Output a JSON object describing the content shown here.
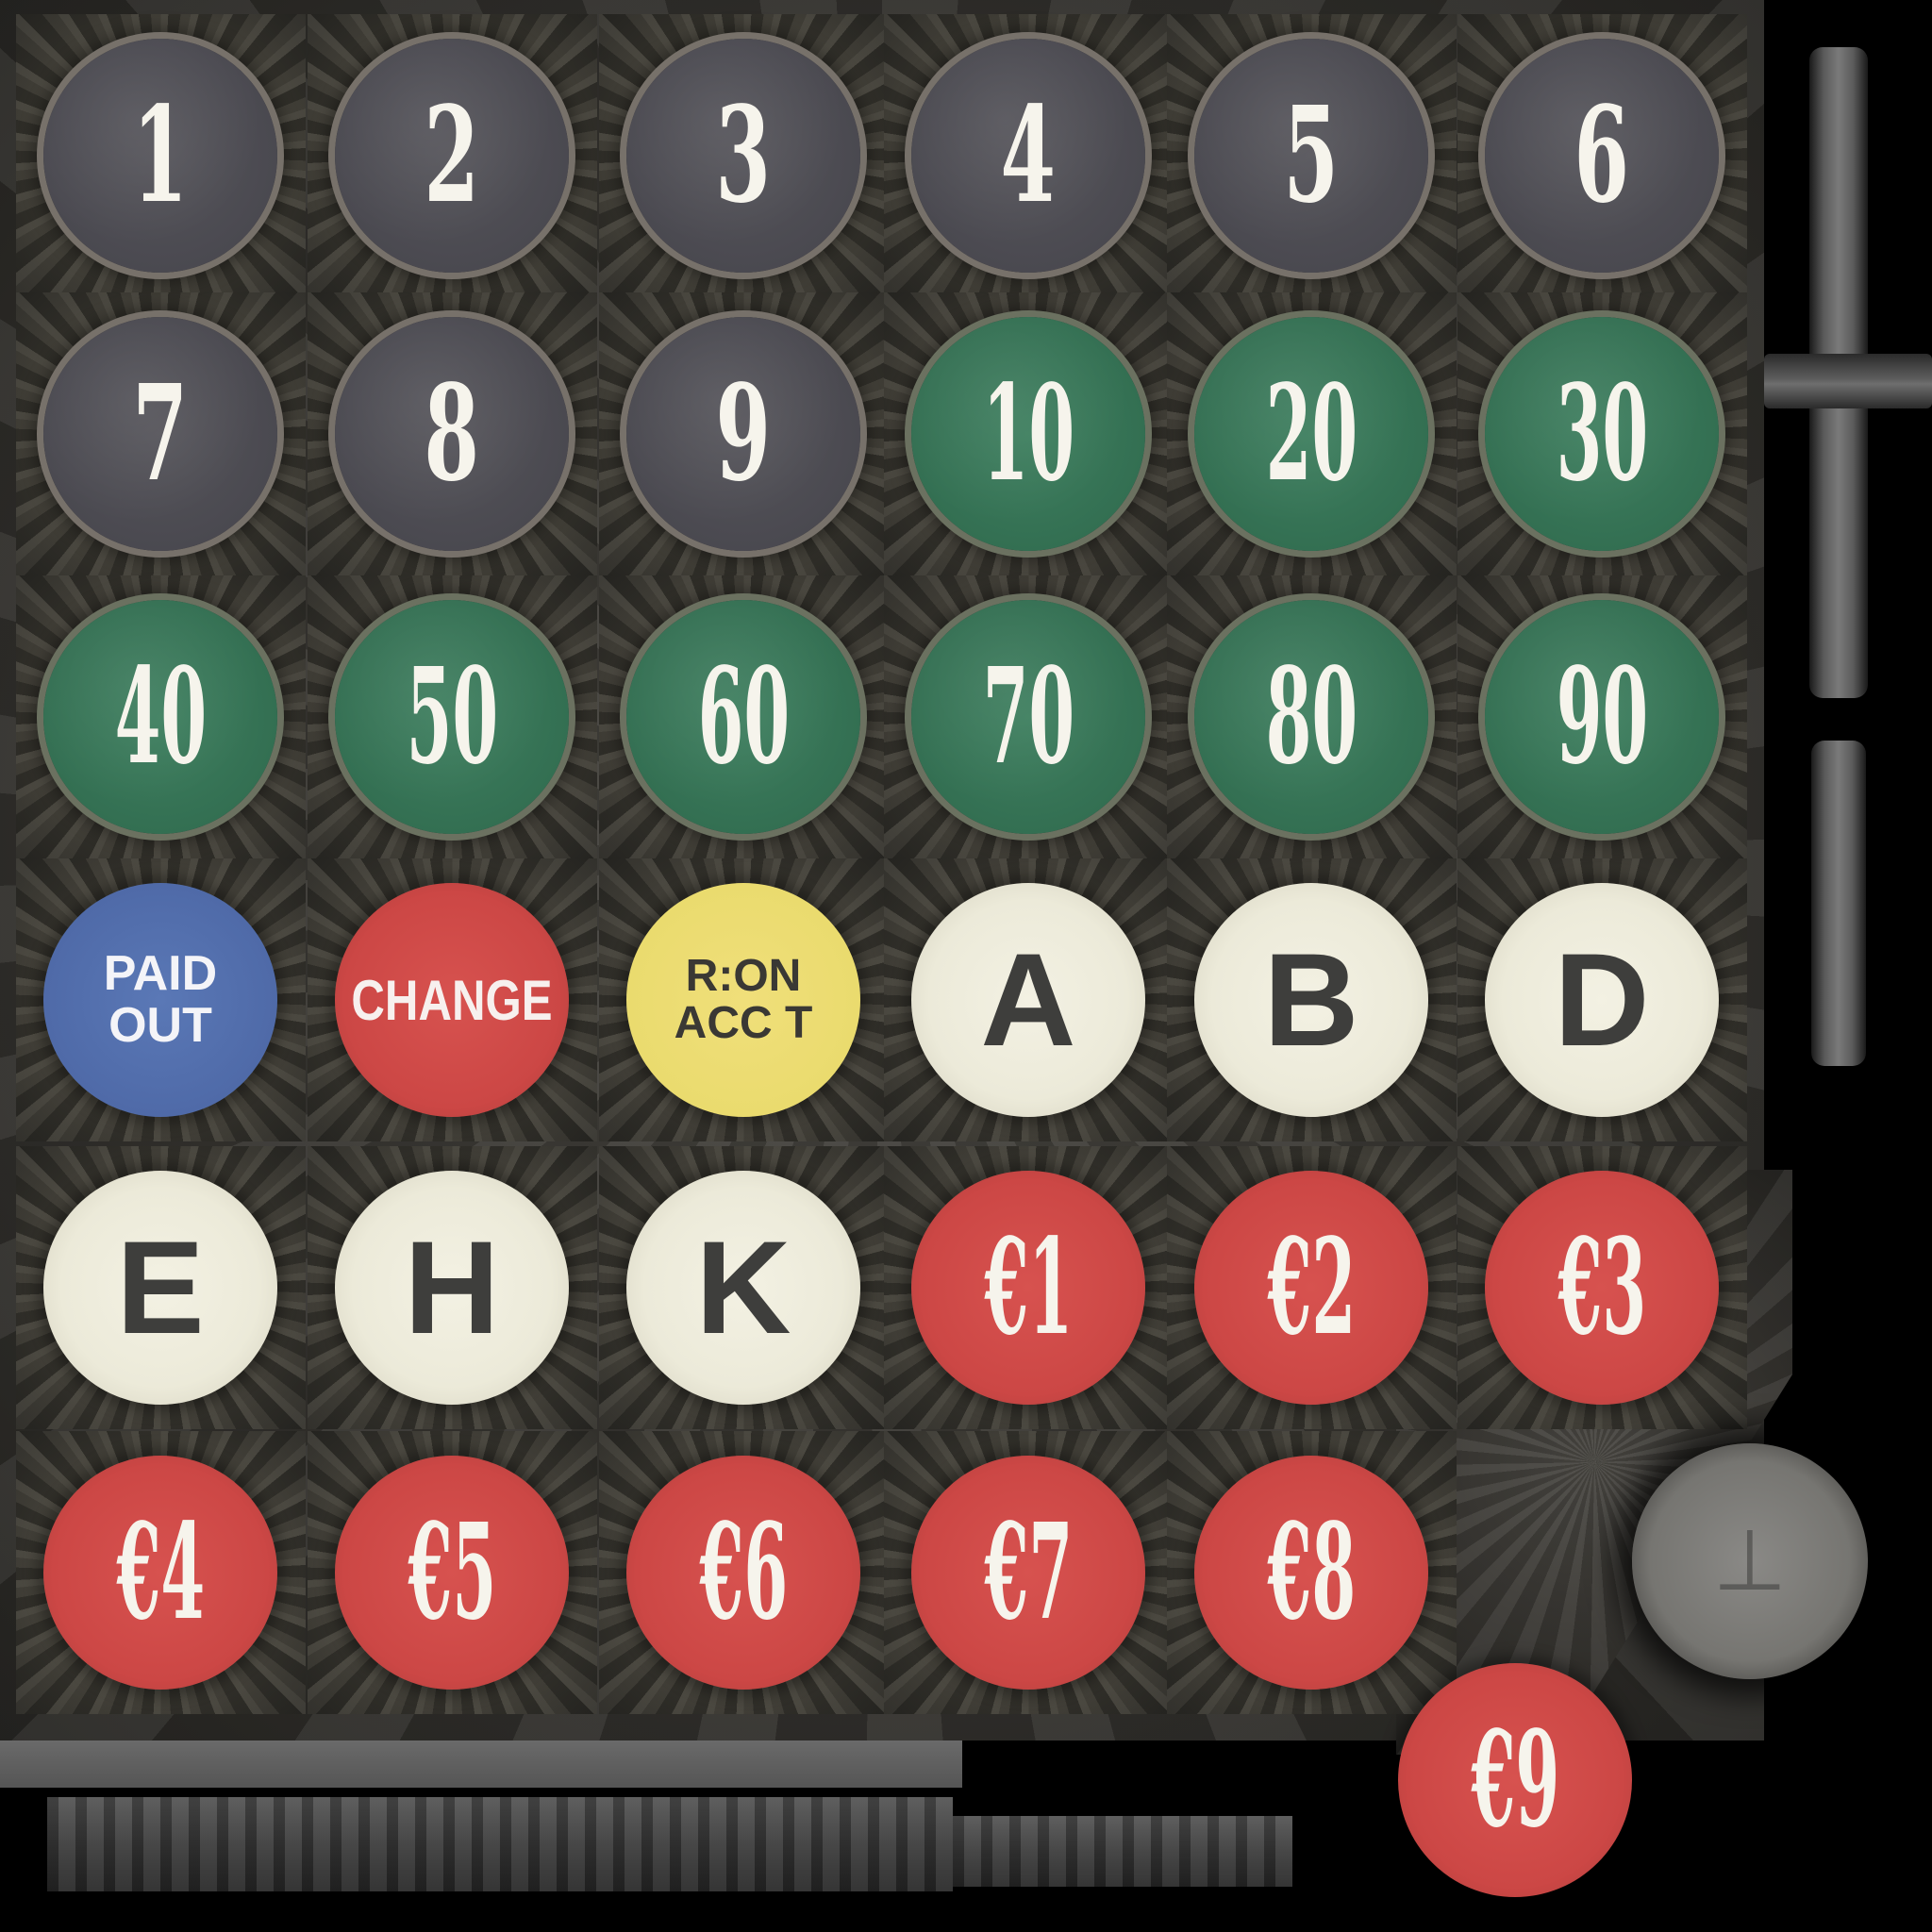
{
  "keypad": {
    "rows": [
      [
        "1",
        "2",
        "3",
        "4",
        "5",
        "6"
      ],
      [
        "7",
        "8",
        "9",
        "10",
        "20",
        "30"
      ],
      [
        "40",
        "50",
        "60",
        "70",
        "80",
        "90"
      ],
      [
        "PAID\nOUT",
        "CHANGE",
        "R:ON\nACC T",
        "A",
        "B",
        "D"
      ],
      [
        "E",
        "H",
        "K",
        "€1",
        "€2",
        "€3"
      ],
      [
        "€4",
        "€5",
        "€6",
        "€7",
        "€8"
      ]
    ],
    "extra_key": "€9"
  },
  "colors": {
    "grey_key": "#4c4b51",
    "green_key": "#357054",
    "cream_key": "#ecead9",
    "red_key": "#cc4745",
    "blue_key": "#4f6aa8",
    "yellow_key": "#eadb6e",
    "background": "#000000"
  }
}
